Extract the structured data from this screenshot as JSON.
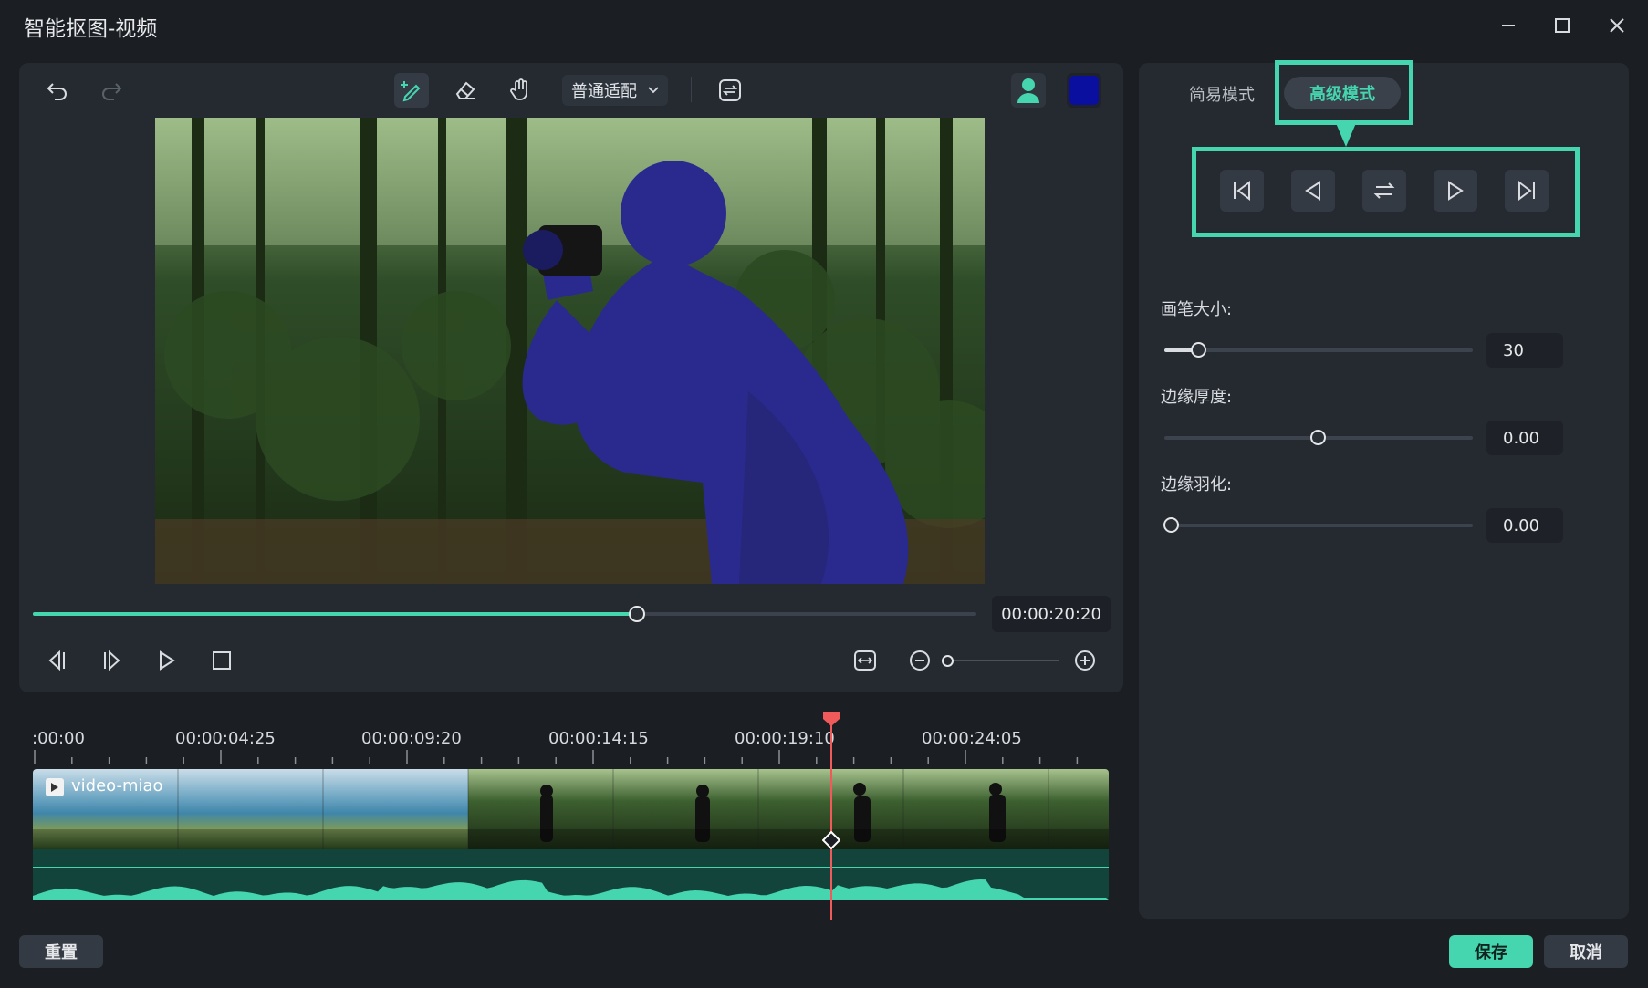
{
  "window": {
    "title": "智能抠图-视频",
    "minimize_icon": "minimize-icon",
    "maximize_icon": "maximize-icon",
    "close_icon": "close-icon"
  },
  "toolbar": {
    "fit_select": "普通适配",
    "accent_color": "#45d6b0",
    "mask_color": "#0b0fa0"
  },
  "player": {
    "time": "00:00:20:20",
    "progress_fraction": 0.64
  },
  "timeline": {
    "ruler_labels": [
      ":00:00",
      "00:00:04:25",
      "00:00:09:20",
      "00:00:14:15",
      "00:00:19:10",
      "00:00:24:05"
    ],
    "clip_name": "video-miao"
  },
  "right_panel": {
    "tabs": [
      "简易模式",
      "高级模式"
    ],
    "active_tab": "高级模式",
    "brush_size_label": "画笔大小:",
    "brush_size_value": "30",
    "edge_thickness_label": "边缘厚度:",
    "edge_thickness_value": "0.00",
    "edge_feather_label": "边缘羽化:",
    "edge_feather_value": "0.00"
  },
  "footer": {
    "reset": "重置",
    "save": "保存",
    "cancel": "取消"
  }
}
